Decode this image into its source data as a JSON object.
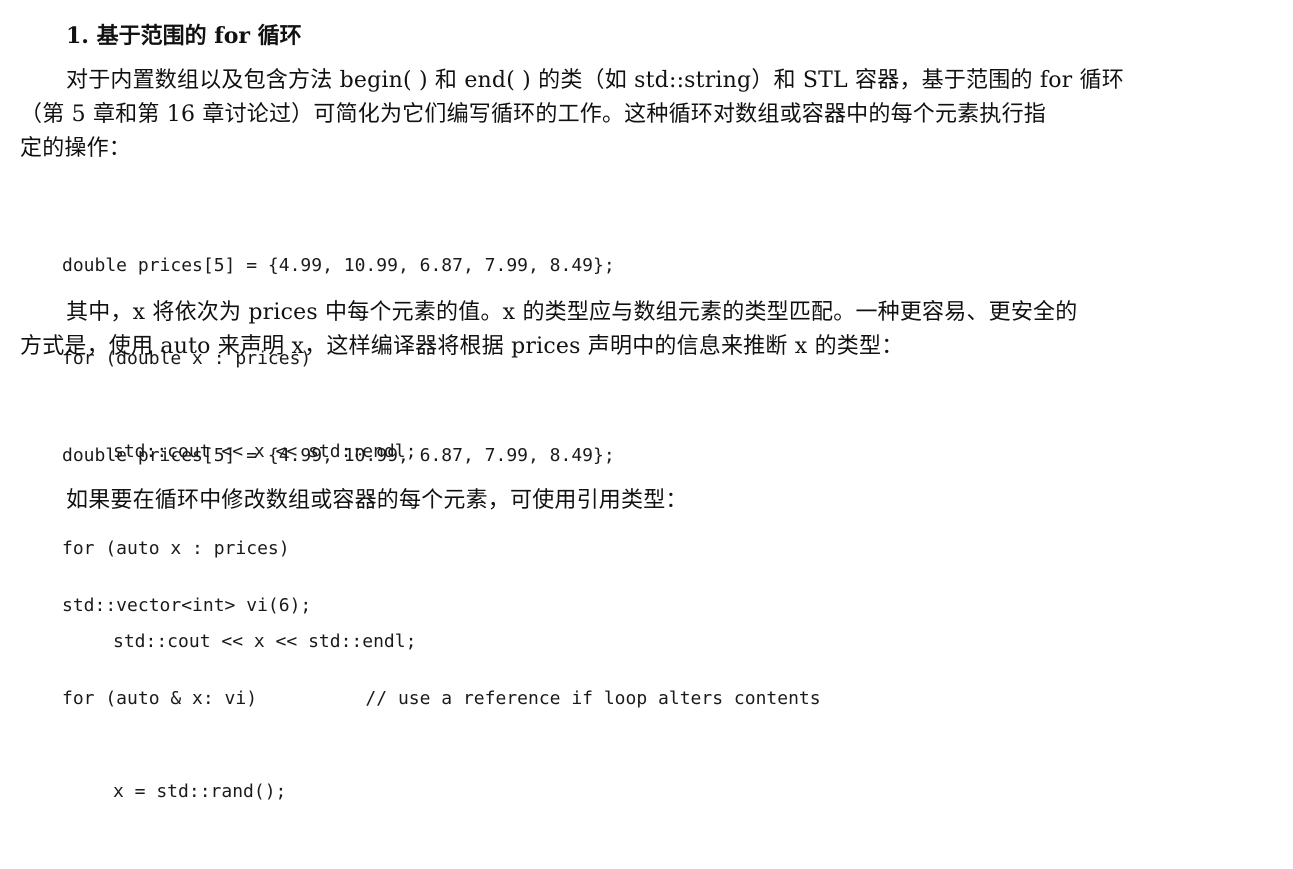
{
  "section": {
    "heading": "1. 基于范围的 for 循环"
  },
  "paragraph1": {
    "lines": [
      "对于内置数组以及包含方法 begin( ) 和 end( ) 的类（如 std::string）和 STL 容器，基于范围的 for 循环",
      "（第 5 章和第 16 章讨论过）可简化为它们编写循环的工作。这种循环对数组或容器中的每个元素执行指",
      "定的操作："
    ]
  },
  "code1": {
    "lines": [
      "double prices[5] = {4.99, 10.99, 6.87, 7.99, 8.49};",
      "for (double x : prices)",
      "std::cout << x << std::endl;"
    ]
  },
  "paragraph2": {
    "lines": [
      "其中，x 将依次为 prices 中每个元素的值。x 的类型应与数组元素的类型匹配。一种更容易、更安全的",
      "方式是，使用 auto 来声明 x，这样编译器将根据 prices 声明中的信息来推断 x 的类型："
    ]
  },
  "code2": {
    "lines": [
      "double prices[5] = {4.99, 10.99, 6.87, 7.99, 8.49};",
      "for (auto x : prices)",
      "std::cout << x << std::endl;"
    ]
  },
  "paragraph3": {
    "lines": [
      "如果要在循环中修改数组或容器的每个元素，可使用引用类型："
    ]
  },
  "code3": {
    "lines": [
      "std::vector<int> vi(6);",
      "for (auto & x: vi)          // use a reference if loop alters contents",
      "x = std::rand();"
    ]
  }
}
